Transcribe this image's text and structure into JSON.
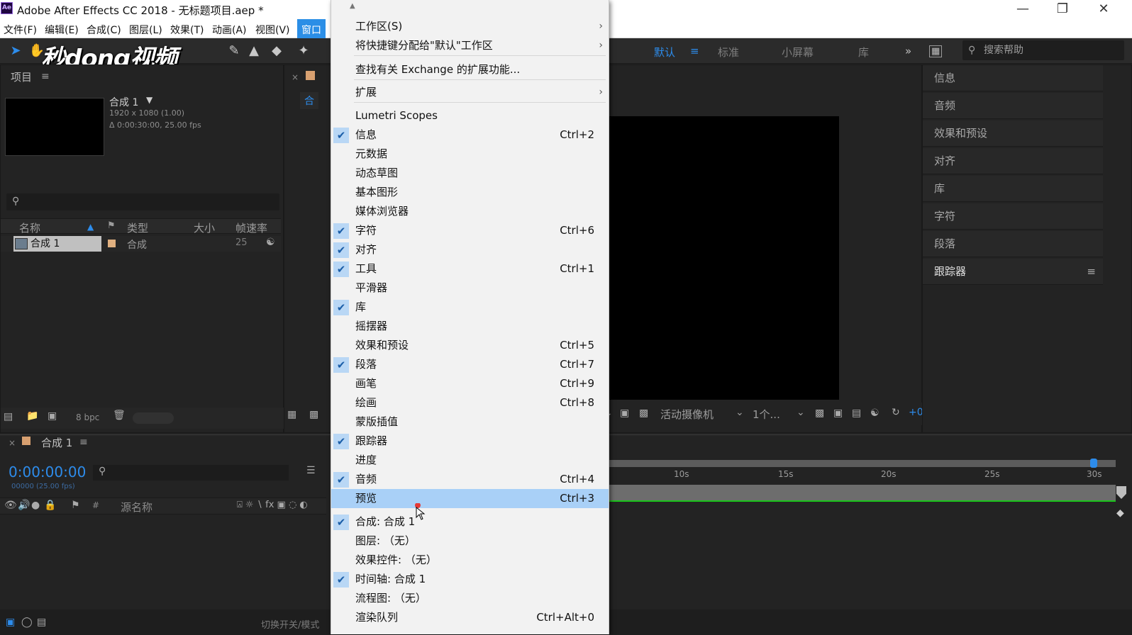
{
  "window": {
    "title": "Adobe After Effects CC 2018 - 无标题项目.aep *",
    "app_icon": "Ae",
    "controls": [
      "minimize-icon",
      "restore-icon",
      "close-icon"
    ]
  },
  "menubar": {
    "items": [
      "文件(F)",
      "编辑(E)",
      "合成(C)",
      "图层(L)",
      "效果(T)",
      "动画(A)",
      "视图(V)",
      "窗口"
    ]
  },
  "toolbar": {
    "logo_text": "秒dong视频",
    "workspaces": [
      "默认",
      "标准",
      "小屏幕",
      "库"
    ],
    "selected_workspace": "默认",
    "help_search_placeholder": "搜索帮助"
  },
  "project_panel": {
    "title": "项目",
    "comp_name": "合成 1",
    "comp_size": "1920 x 1080 (1.00)",
    "comp_duration": "Δ 0:00:30:00, 25.00 fps",
    "columns": [
      "名称",
      "类型",
      "大小",
      "帧速率"
    ],
    "rows": [
      {
        "name": "合成 1",
        "type": "合成",
        "size": "",
        "fps": "25"
      }
    ],
    "bpc": "8 bpc"
  },
  "comp_viewer": {
    "tab_partial": "合",
    "camera": "活动摄像机",
    "views": "1个..."
  },
  "right_panels": [
    "信息",
    "音频",
    "效果和预设",
    "对齐",
    "库",
    "字符",
    "段落",
    "跟踪器"
  ],
  "timeline": {
    "tab_title": "合成 1",
    "timecode": "0:00:00:00",
    "timecode_sub": "00000 (25.00 fps)",
    "column_source": "源名称",
    "column_hash": "#",
    "ruler_ticks": [
      "10s",
      "15s",
      "20s",
      "25s",
      "30s"
    ],
    "footer_text": "切换开关/模式"
  },
  "dropdown": {
    "items": [
      {
        "label": "工作区(S)",
        "shortcut": "",
        "checked": false,
        "submenu": true
      },
      {
        "label": "将快捷键分配给\"默认\"工作区",
        "shortcut": "",
        "checked": false,
        "submenu": true
      },
      {
        "label": "查找有关 Exchange 的扩展功能...",
        "shortcut": "",
        "checked": false,
        "submenu": false
      },
      {
        "label": "扩展",
        "shortcut": "",
        "checked": false,
        "submenu": true
      },
      {
        "label": "Lumetri Scopes",
        "shortcut": "",
        "checked": false,
        "submenu": false
      },
      {
        "label": "信息",
        "shortcut": "Ctrl+2",
        "checked": true,
        "submenu": false
      },
      {
        "label": "元数据",
        "shortcut": "",
        "checked": false,
        "submenu": false
      },
      {
        "label": "动态草图",
        "shortcut": "",
        "checked": false,
        "submenu": false
      },
      {
        "label": "基本图形",
        "shortcut": "",
        "checked": false,
        "submenu": false
      },
      {
        "label": "媒体浏览器",
        "shortcut": "",
        "checked": false,
        "submenu": false
      },
      {
        "label": "字符",
        "shortcut": "Ctrl+6",
        "checked": true,
        "submenu": false
      },
      {
        "label": "对齐",
        "shortcut": "",
        "checked": true,
        "submenu": false
      },
      {
        "label": "工具",
        "shortcut": "Ctrl+1",
        "checked": true,
        "submenu": false
      },
      {
        "label": "平滑器",
        "shortcut": "",
        "checked": false,
        "submenu": false
      },
      {
        "label": "库",
        "shortcut": "",
        "checked": true,
        "submenu": false
      },
      {
        "label": "摇摆器",
        "shortcut": "",
        "checked": false,
        "submenu": false
      },
      {
        "label": "效果和预设",
        "shortcut": "Ctrl+5",
        "checked": false,
        "submenu": false
      },
      {
        "label": "段落",
        "shortcut": "Ctrl+7",
        "checked": true,
        "submenu": false
      },
      {
        "label": "画笔",
        "shortcut": "Ctrl+9",
        "checked": false,
        "submenu": false
      },
      {
        "label": "绘画",
        "shortcut": "Ctrl+8",
        "checked": false,
        "submenu": false
      },
      {
        "label": "蒙版插值",
        "shortcut": "",
        "checked": false,
        "submenu": false
      },
      {
        "label": "跟踪器",
        "shortcut": "",
        "checked": true,
        "submenu": false
      },
      {
        "label": "进度",
        "shortcut": "",
        "checked": false,
        "submenu": false
      },
      {
        "label": "音频",
        "shortcut": "Ctrl+4",
        "checked": true,
        "submenu": false
      },
      {
        "label": "预览",
        "shortcut": "Ctrl+3",
        "checked": false,
        "submenu": false,
        "highlighted": true
      },
      {
        "label": "合成: 合成 1",
        "shortcut": "",
        "checked": true,
        "submenu": false
      },
      {
        "label": "图层: （无）",
        "shortcut": "",
        "checked": false,
        "submenu": false
      },
      {
        "label": "效果控件: （无）",
        "shortcut": "",
        "checked": false,
        "submenu": false
      },
      {
        "label": "时间轴: 合成 1",
        "shortcut": "",
        "checked": true,
        "submenu": false
      },
      {
        "label": "流程图: （无）",
        "shortcut": "",
        "checked": false,
        "submenu": false
      },
      {
        "label": "渲染队列",
        "shortcut": "Ctrl+Alt+0",
        "checked": false,
        "submenu": false
      }
    ]
  },
  "colors": {
    "accent": "#2d8ceb",
    "menu_highlight": "#a9d0f7",
    "check_bg": "#b9d7f5",
    "timeline_green": "#19c51a"
  }
}
